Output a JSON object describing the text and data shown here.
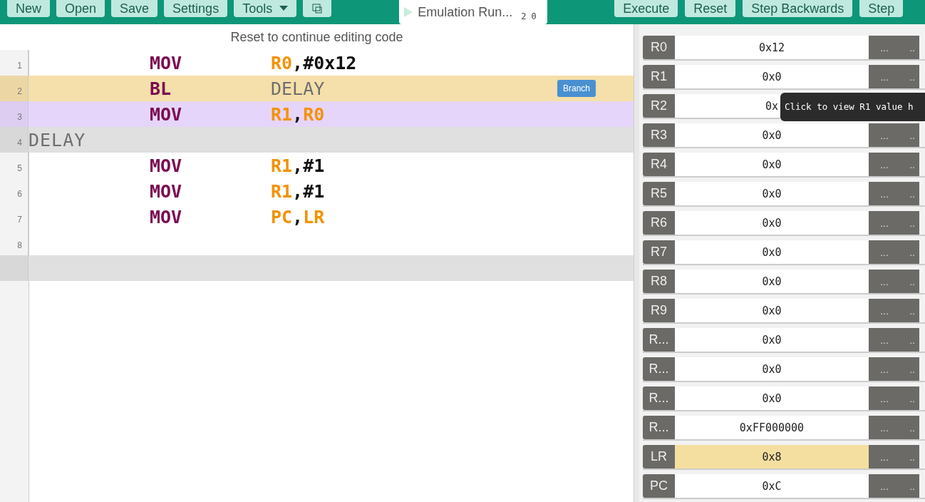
{
  "toolbar": {
    "left_buttons": [
      {
        "label": "New",
        "kind": "text"
      },
      {
        "label": "Open",
        "kind": "text"
      },
      {
        "label": "Save",
        "kind": "text"
      },
      {
        "label": "Settings",
        "kind": "text"
      },
      {
        "label": "Tools",
        "kind": "dropdown"
      },
      {
        "kind": "icon"
      }
    ],
    "status": {
      "text": "Emulation Run...",
      "counters": [
        "2",
        "0"
      ]
    },
    "right_buttons": [
      {
        "label": "Execute",
        "kind": "text"
      },
      {
        "label": "Reset",
        "kind": "text"
      },
      {
        "label": "Step Backwards",
        "kind": "text"
      },
      {
        "label": "Step",
        "kind": "text"
      }
    ]
  },
  "editor": {
    "notice": "Reset to continue editing code",
    "lines": [
      {
        "number": "1",
        "mnemonic": "MOV",
        "operands": [
          {
            "text": "R0",
            "kind": "register"
          },
          {
            "text": ",#0x12",
            "kind": "plain"
          }
        ]
      },
      {
        "number": "2",
        "color": "#f5dfaa",
        "mnemonic": "BL",
        "operands": [
          {
            "text": "DELAY",
            "kind": "label"
          }
        ],
        "badge": "Branch"
      },
      {
        "number": "3",
        "color": "#e6d5fa",
        "mnemonic": "MOV",
        "operands": [
          {
            "text": "R1",
            "kind": "register"
          },
          {
            "text": ",",
            "kind": "plain"
          },
          {
            "text": "R0",
            "kind": "register"
          }
        ]
      },
      {
        "number": "4",
        "color": "#e0e0e0",
        "label": "DELAY"
      },
      {
        "number": "5",
        "mnemonic": "MOV",
        "operands": [
          {
            "text": "R1",
            "kind": "register"
          },
          {
            "text": ",#1",
            "kind": "plain"
          }
        ]
      },
      {
        "number": "6",
        "mnemonic": "MOV",
        "operands": [
          {
            "text": "R1",
            "kind": "register"
          },
          {
            "text": ",#1",
            "kind": "plain"
          }
        ]
      },
      {
        "number": "7",
        "mnemonic": "MOV",
        "operands": [
          {
            "text": "PC",
            "kind": "register"
          },
          {
            "text": ",",
            "kind": "plain"
          },
          {
            "text": "LR",
            "kind": "register"
          }
        ]
      },
      {
        "number": "8"
      },
      {
        "color": "#e0e0e0"
      }
    ]
  },
  "registers": [
    {
      "name": "R0",
      "value": "0x12",
      "highlighted": false
    },
    {
      "name": "R1",
      "value": "0x0",
      "highlighted": false
    },
    {
      "name": "R2",
      "value": "0x",
      "highlighted": false,
      "covered": true
    },
    {
      "name": "R3",
      "value": "0x0",
      "highlighted": false
    },
    {
      "name": "R4",
      "value": "0x0",
      "highlighted": false
    },
    {
      "name": "R5",
      "value": "0x0",
      "highlighted": false
    },
    {
      "name": "R6",
      "value": "0x0",
      "highlighted": false
    },
    {
      "name": "R7",
      "value": "0x0",
      "highlighted": false
    },
    {
      "name": "R8",
      "value": "0x0",
      "highlighted": false
    },
    {
      "name": "R9",
      "value": "0x0",
      "highlighted": false
    },
    {
      "name": "R...",
      "value": "0x0",
      "highlighted": false
    },
    {
      "name": "R...",
      "value": "0x0",
      "highlighted": false
    },
    {
      "name": "R...",
      "value": "0x0",
      "highlighted": false
    },
    {
      "name": "R...",
      "value": "0xFF000000",
      "highlighted": false
    },
    {
      "name": "LR",
      "value": "0x8",
      "highlighted": true
    },
    {
      "name": "PC",
      "value": "0xC",
      "highlighted": false
    }
  ],
  "register_actions": [
    "...",
    ".."
  ],
  "tooltip": "Click to view R1 value h"
}
